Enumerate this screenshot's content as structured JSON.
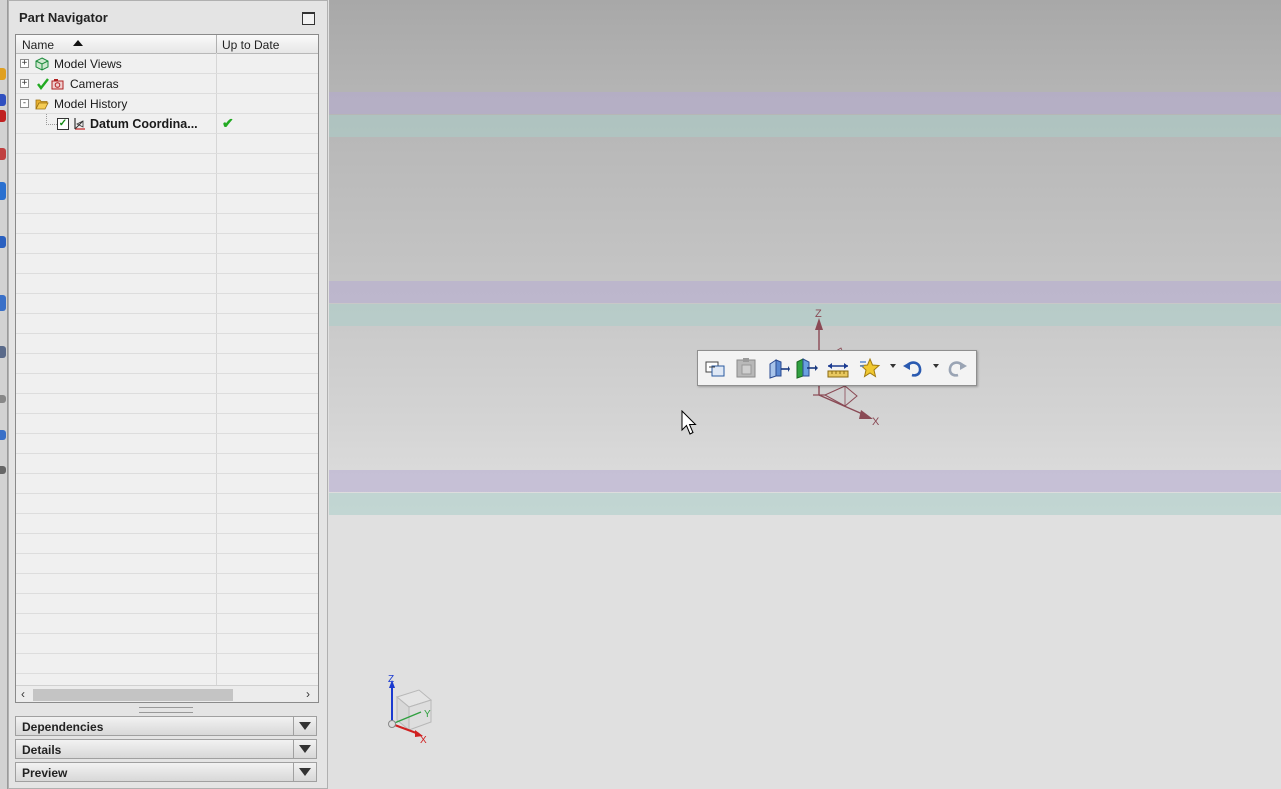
{
  "navigator": {
    "title": "Part Navigator",
    "columns": {
      "name": "Name",
      "up_to_date": "Up to Date"
    },
    "rows": [
      {
        "label": "Model Views",
        "expander": "+",
        "icon": "model-views-icon"
      },
      {
        "label": "Cameras",
        "expander": "+",
        "icon": "camera-icon",
        "status_icon": "check-icon"
      },
      {
        "label": "Model History",
        "expander": "-",
        "icon": "folder-open-icon"
      },
      {
        "label": "Datum Coordina...",
        "icon": "datum-csys-icon",
        "checkbox": "✓",
        "uptodate": "✔"
      }
    ],
    "scroll_left": "‹",
    "scroll_right": "›"
  },
  "panels": [
    {
      "label": "Dependencies"
    },
    {
      "label": "Details"
    },
    {
      "label": "Preview"
    }
  ],
  "viewport": {
    "csys_labels": {
      "z": "Z",
      "x": "X"
    },
    "triad_labels": {
      "z": "Z",
      "y": "Y",
      "x": "X"
    },
    "toolbar_icons": [
      "fit-view-icon",
      "paste-icon",
      "extrude-icon",
      "revolve-icon",
      "measure-distance-icon",
      "favorites-icon",
      "undo-icon",
      "redo-icon"
    ]
  },
  "colors": {
    "check_green": "#22aa22",
    "axis_maroon": "#8a4a55",
    "triad_blue": "#1a3ad0",
    "triad_red": "#d02020"
  }
}
